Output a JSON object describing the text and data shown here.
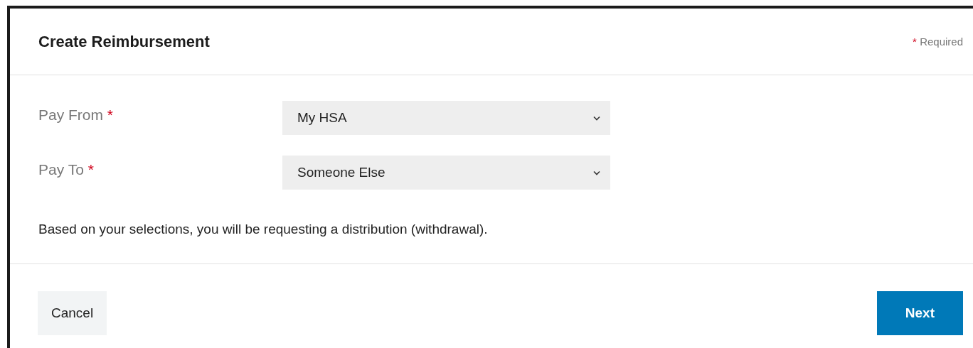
{
  "dialog": {
    "title": "Create Reimbursement",
    "required_note": {
      "mark": "*",
      "text": "Required"
    },
    "fields": [
      {
        "label": "Pay From",
        "mark": "*",
        "value": "My HSA"
      },
      {
        "label": "Pay To",
        "mark": "*",
        "value": "Someone Else"
      }
    ],
    "message": "Based on your selections, you will be requesting a distribution (withdrawal).",
    "buttons": [
      {
        "label": "Cancel",
        "kind": "secondary"
      },
      {
        "label": "Next",
        "kind": "primary"
      }
    ]
  }
}
